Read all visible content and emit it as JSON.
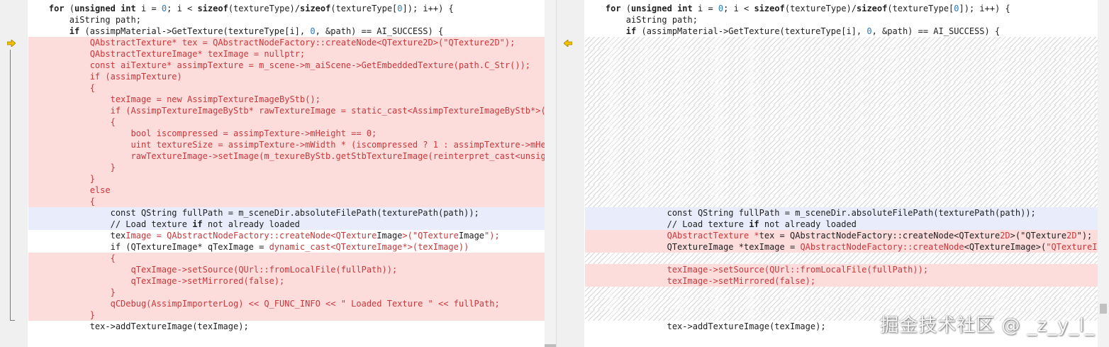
{
  "left": {
    "lines": [
      {
        "state": "normal",
        "text": "for (unsigned int i = 0; i < sizeof(textureType)/sizeof(textureType[0]); i++) {",
        "indent": 1
      },
      {
        "state": "normal",
        "text": "aiString path;",
        "indent": 2
      },
      {
        "state": "normal",
        "text": "if (assimpMaterial->GetTexture(textureType[i], 0, &path) == AI_SUCCESS) {",
        "indent": 2
      },
      {
        "state": "deleted",
        "text": "QAbstractTexture* tex = QAbstractNodeFactory::createNode<QTexture2D>(\"QTexture2D\");",
        "indent": 3
      },
      {
        "state": "deleted",
        "text": "QAbstractTextureImage* texImage = nullptr;",
        "indent": 3
      },
      {
        "state": "deleted",
        "text": "const aiTexture* assimpTexture = m_scene->m_aiScene->GetEmbeddedTexture(path.C_Str());",
        "indent": 3
      },
      {
        "state": "deleted",
        "text": "if (assimpTexture)",
        "indent": 3
      },
      {
        "state": "deleted",
        "text": "{",
        "indent": 3
      },
      {
        "state": "deleted",
        "text": "texImage = new AssimpTextureImageByStb();",
        "indent": 4
      },
      {
        "state": "deleted",
        "text": "if (AssimpTextureImageByStb* rawTextureImage = static_cast<AssimpTextureImageByStb*>(tex",
        "indent": 4
      },
      {
        "state": "deleted",
        "text": "{",
        "indent": 4
      },
      {
        "state": "deleted",
        "text": "bool iscompressed = assimpTexture->mHeight == 0;",
        "indent": 5
      },
      {
        "state": "deleted",
        "text": "uint textureSize = assimpTexture->mWidth * (iscompressed ? 1 : assimpTexture->mHeigh",
        "indent": 5
      },
      {
        "state": "deleted",
        "text": "rawTextureImage->setImage(m_texureByStb.getStbTextureImage(reinterpret_cast<unsigned",
        "indent": 5
      },
      {
        "state": "deleted",
        "text": "}",
        "indent": 4
      },
      {
        "state": "deleted",
        "text": "}",
        "indent": 3
      },
      {
        "state": "deleted",
        "text": "else",
        "indent": 3
      },
      {
        "state": "deleted",
        "text": "{",
        "indent": 3
      },
      {
        "state": "current",
        "text": "const QString fullPath = m_sceneDir.absoluteFilePath(texturePath(path));",
        "indent": 4
      },
      {
        "state": "current",
        "text": "// Load texture if not already loaded",
        "indent": 4
      },
      {
        "state": "mixed",
        "indent": 4,
        "parts": [
          {
            "t": "tex",
            "hl": false
          },
          {
            "t": "Image = QAbstractNodeFactory::createNode<QTexture",
            "hl": true
          },
          {
            "t": "Image",
            "hl": false
          },
          {
            "t": ">(\"QTexture",
            "hl": true
          },
          {
            "t": "Image",
            "hl": false
          },
          {
            "t": "\");",
            "hl": true
          }
        ]
      },
      {
        "state": "mixed",
        "indent": 4,
        "parts": [
          {
            "t": "if (QTextureImage* qTexImage = ",
            "hl": false
          },
          {
            "t": "dynamic_cast<QTextureImage*>(texImage))",
            "hl": true
          }
        ]
      },
      {
        "state": "deleted",
        "text": "{",
        "indent": 4
      },
      {
        "state": "deleted",
        "text": "qTexImage->setSource(QUrl::fromLocalFile(fullPath));",
        "indent": 5
      },
      {
        "state": "deleted",
        "text": "qTexImage->setMirrored(false);",
        "indent": 5
      },
      {
        "state": "deleted",
        "text": "}",
        "indent": 4
      },
      {
        "state": "deleted",
        "text": "qCDebug(AssimpImporterLog) << Q_FUNC_INFO << \" Loaded Texture \" << fullPath;",
        "indent": 4
      },
      {
        "state": "deleted",
        "text": "}",
        "indent": 3
      },
      {
        "state": "normal",
        "text": "tex->addTextureImage(texImage);",
        "indent": 3
      }
    ]
  },
  "right": {
    "lines": [
      {
        "state": "normal",
        "text": "for (unsigned int i = 0; i < sizeof(textureType)/sizeof(textureType[0]); i++) {",
        "indent": 1
      },
      {
        "state": "normal",
        "text": "aiString path;",
        "indent": 2
      },
      {
        "state": "normal",
        "text": "if (assimpMaterial->GetTexture(textureType[i], 0, &path) == AI_SUCCESS) {",
        "indent": 2
      },
      {
        "state": "hatched"
      },
      {
        "state": "hatched"
      },
      {
        "state": "hatched"
      },
      {
        "state": "hatched"
      },
      {
        "state": "hatched"
      },
      {
        "state": "hatched"
      },
      {
        "state": "hatched"
      },
      {
        "state": "hatched"
      },
      {
        "state": "hatched"
      },
      {
        "state": "hatched"
      },
      {
        "state": "hatched"
      },
      {
        "state": "hatched"
      },
      {
        "state": "hatched"
      },
      {
        "state": "hatched"
      },
      {
        "state": "hatched"
      },
      {
        "state": "current",
        "text": "const QString fullPath = m_sceneDir.absoluteFilePath(texturePath(path));",
        "indent": 4
      },
      {
        "state": "current",
        "text": "// Load texture if not already loaded",
        "indent": 4
      },
      {
        "state": "added",
        "indent": 4,
        "parts": [
          {
            "t": "QAbstractTexture *",
            "hl": true
          },
          {
            "t": "tex = QAbstractNodeFactory::createNode<QTexture",
            "hl": false
          },
          {
            "t": "2D",
            "hl": true
          },
          {
            "t": ">(\"QTexture",
            "hl": false
          },
          {
            "t": "2D",
            "hl": true
          },
          {
            "t": "\");",
            "hl": false
          }
        ]
      },
      {
        "state": "added",
        "indent": 4,
        "parts": [
          {
            "t": "QTextureImage *texImage = ",
            "hl": false
          },
          {
            "t": "QAbstractNodeFactory::createNode",
            "hl": true
          },
          {
            "t": "<QTextureImage>(",
            "hl": false
          },
          {
            "t": "\"QTextureImage\"",
            "hl": true
          },
          {
            "t": ");",
            "hl": false
          }
        ]
      },
      {
        "state": "hatched"
      },
      {
        "state": "added",
        "text": "texImage->setSource(QUrl::fromLocalFile(fullPath));",
        "indent": 4
      },
      {
        "state": "added",
        "text": "texImage->setMirrored(false);",
        "indent": 4
      },
      {
        "state": "hatched"
      },
      {
        "state": "hatched"
      },
      {
        "state": "hatched"
      },
      {
        "state": "normal",
        "text": "tex->addTextureImage(texImage);",
        "indent": 4
      }
    ]
  },
  "watermark": "掘金技术社区 @ _z_y_l_",
  "icons": {
    "change_marker_left": "arrow-right-icon",
    "change_marker_right": "arrow-left-icon"
  },
  "colors": {
    "deleted_bg": "#fddcdc",
    "deleted_text": "#c8383b",
    "current_bg": "#e8ecfb",
    "marker": "#e8b400"
  }
}
